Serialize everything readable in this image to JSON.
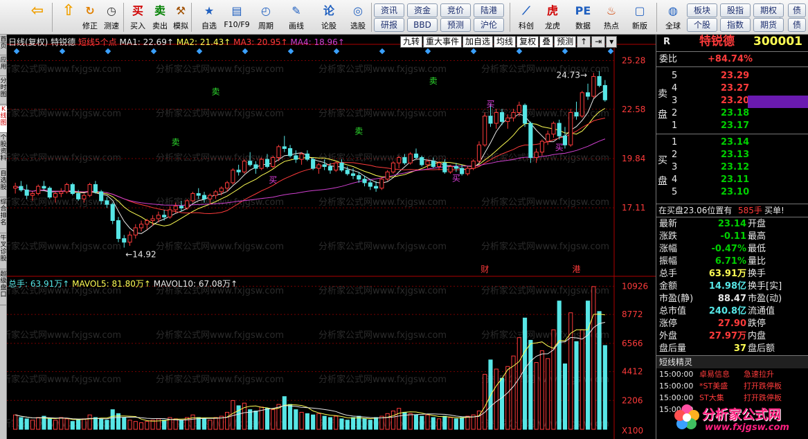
{
  "toolbar": {
    "buttons": [
      {
        "label": "",
        "icon": "back-arrow-icon",
        "glyph": "⇦",
        "color": "#f0a000"
      },
      {
        "label": "",
        "icon": "up-arrow-icon",
        "glyph": "⇧",
        "color": "#f0a000"
      },
      {
        "label": "修正",
        "icon": "refresh-icon",
        "glyph": "↻",
        "color": "#e08000"
      },
      {
        "label": "测速",
        "icon": "clock-icon",
        "glyph": "◷",
        "color": "#333333"
      },
      {
        "label": "买入",
        "icon": "buy-icon",
        "glyph": "买",
        "color": "#d00000"
      },
      {
        "label": "卖出",
        "icon": "sell-icon",
        "glyph": "卖",
        "color": "#008000"
      },
      {
        "label": "模拟",
        "icon": "gavel-icon",
        "glyph": "⚒",
        "color": "#a05000"
      },
      {
        "label": "自选",
        "icon": "star-icon",
        "glyph": "★",
        "color": "#2060c0"
      },
      {
        "label": "F10/F9",
        "icon": "f10-icon",
        "glyph": "▤",
        "color": "#2060c0"
      },
      {
        "label": "周期",
        "icon": "period-icon",
        "glyph": "◴",
        "color": "#2060c0"
      },
      {
        "label": "画线",
        "icon": "pencil-icon",
        "glyph": "✎",
        "color": "#2060c0"
      },
      {
        "label": "论股",
        "icon": "discuss-icon",
        "glyph": "论",
        "color": "#2060c0"
      },
      {
        "label": "选股",
        "icon": "select-stock-icon",
        "glyph": "◎",
        "color": "#2060c0"
      },
      {
        "label": "科创",
        "icon": "chart-icon",
        "glyph": "⟋",
        "color": "#2060c0"
      },
      {
        "label": "龙虎",
        "icon": "dragon-icon",
        "glyph": "虎",
        "color": "#d00000"
      },
      {
        "label": "数据",
        "icon": "pe-icon",
        "glyph": "PE",
        "color": "#2060c0"
      },
      {
        "label": "热点",
        "icon": "fire-icon",
        "glyph": "♨",
        "color": "#d04000"
      },
      {
        "label": "新版",
        "icon": "new-version-icon",
        "glyph": "▢",
        "color": "#2060c0"
      },
      {
        "label": "全球",
        "icon": "globe-icon",
        "glyph": "◍",
        "color": "#2060c0"
      }
    ],
    "small_buttons": [
      "资讯",
      "资金",
      "竞价",
      "陆港",
      "研报",
      "BBD",
      "预测",
      "沪伦",
      "板块",
      "股指",
      "期权",
      "个股",
      "指数",
      "期货",
      "债",
      "债"
    ]
  },
  "left_tabs": [
    "首页",
    "应用",
    "分时图",
    "K线图",
    "个股资料",
    "自选股",
    "综合排名",
    "牛叉诊股",
    "超级盘口"
  ],
  "chart": {
    "info": {
      "period": "日线(复权)",
      "name": "特锐德",
      "indicator": "短线5个点",
      "ma1": "MA1: 22.69↑",
      "ma2": "MA2: 21.43↑",
      "ma3": "MA3: 20.95↑",
      "ma4": "MA4: 18.96↑"
    },
    "menu": [
      "九转",
      "重大事件",
      "加自选",
      "均线",
      "复权",
      "叠",
      "预测"
    ],
    "menu_icons": [
      "↑",
      "⇥",
      "▾"
    ],
    "price_ticks": [
      "25.28",
      "22.58",
      "19.84",
      "17.11"
    ],
    "volume_ticks": [
      "10926",
      "8772",
      "6566",
      "4412",
      "2206",
      "X100"
    ],
    "vol_info": {
      "total": "总手: 63.91万↑",
      "mavol5": "MAVOL5: 81.80万↑",
      "mavol10": "MAVOL10: 67.08万↑"
    },
    "labels": {
      "high": "24.73",
      "low": "14.92",
      "cai": "财",
      "gang": "港"
    },
    "signals": [
      "卖",
      "卖",
      "卖",
      "卖",
      "买",
      "买",
      "买",
      "买"
    ],
    "watermark": "分析家公式网www.fxjgsw.com",
    "colors": {
      "up": "#ff3b3b",
      "down": "#57e6e6",
      "ma1": "#e8e8e8",
      "ma2": "#ffff54",
      "ma3": "#ff3b3b",
      "ma4": "#d040d0"
    }
  },
  "chart_data": {
    "type": "candlestick",
    "price_range": [
      13.5,
      25.8
    ],
    "volume_range": [
      0,
      11000
    ],
    "candles": [
      [
        18.2,
        18.5,
        17.9,
        18.3
      ],
      [
        18.3,
        18.6,
        18.0,
        18.1
      ],
      [
        18.1,
        18.4,
        17.6,
        17.8
      ],
      [
        17.8,
        18.0,
        17.5,
        17.9
      ],
      [
        17.9,
        18.4,
        17.8,
        18.3
      ],
      [
        18.3,
        18.6,
        18.1,
        18.2
      ],
      [
        18.2,
        18.3,
        17.6,
        17.7
      ],
      [
        17.7,
        18.0,
        17.4,
        17.9
      ],
      [
        17.9,
        18.2,
        17.7,
        18.0
      ],
      [
        18.0,
        18.5,
        17.9,
        18.4
      ],
      [
        18.4,
        18.5,
        17.8,
        17.9
      ],
      [
        17.9,
        18.1,
        17.5,
        17.6
      ],
      [
        17.6,
        17.9,
        17.4,
        17.8
      ],
      [
        17.8,
        18.5,
        17.7,
        18.4
      ],
      [
        18.4,
        18.6,
        17.9,
        18.0
      ],
      [
        18.0,
        18.1,
        17.3,
        17.5
      ],
      [
        17.5,
        17.7,
        17.1,
        17.3
      ],
      [
        17.3,
        17.4,
        16.2,
        16.4
      ],
      [
        16.4,
        16.6,
        15.2,
        15.4
      ],
      [
        15.4,
        15.6,
        14.9,
        15.2
      ],
      [
        15.2,
        15.8,
        15.0,
        15.6
      ],
      [
        15.6,
        16.2,
        15.4,
        16.0
      ],
      [
        16.0,
        16.4,
        15.8,
        16.2
      ],
      [
        16.2,
        16.5,
        15.9,
        16.4
      ],
      [
        16.4,
        16.7,
        16.1,
        16.5
      ],
      [
        16.5,
        16.9,
        16.3,
        16.7
      ],
      [
        16.7,
        17.0,
        16.4,
        16.6
      ],
      [
        16.6,
        17.2,
        16.5,
        17.0
      ],
      [
        17.0,
        17.4,
        16.8,
        17.2
      ],
      [
        17.2,
        17.5,
        16.9,
        17.1
      ],
      [
        17.1,
        17.6,
        17.0,
        17.5
      ],
      [
        17.5,
        18.0,
        17.4,
        17.9
      ],
      [
        17.9,
        18.2,
        17.6,
        17.8
      ],
      [
        17.8,
        18.0,
        17.4,
        17.6
      ],
      [
        17.6,
        17.9,
        17.3,
        17.8
      ],
      [
        17.8,
        18.1,
        17.6,
        18.0
      ],
      [
        18.0,
        18.3,
        17.8,
        18.2
      ],
      [
        18.2,
        18.6,
        18.0,
        18.5
      ],
      [
        18.5,
        19.3,
        18.4,
        19.2
      ],
      [
        19.2,
        19.5,
        18.9,
        19.1
      ],
      [
        19.1,
        19.8,
        19.0,
        19.7
      ],
      [
        19.7,
        20.2,
        19.4,
        19.5
      ],
      [
        19.5,
        19.7,
        19.0,
        19.3
      ],
      [
        19.3,
        19.9,
        19.2,
        19.8
      ],
      [
        19.8,
        20.1,
        19.3,
        19.4
      ],
      [
        19.4,
        20.0,
        19.3,
        19.9
      ],
      [
        19.9,
        20.6,
        19.7,
        20.5
      ],
      [
        20.5,
        21.1,
        20.2,
        20.4
      ],
      [
        20.4,
        20.6,
        19.9,
        20.0
      ],
      [
        20.0,
        20.3,
        19.6,
        19.8
      ],
      [
        19.8,
        20.2,
        19.5,
        20.1
      ],
      [
        20.1,
        20.3,
        19.7,
        19.8
      ],
      [
        19.8,
        19.9,
        19.2,
        19.3
      ],
      [
        19.3,
        19.6,
        19.0,
        19.5
      ],
      [
        19.5,
        19.8,
        19.2,
        19.4
      ],
      [
        19.4,
        19.6,
        19.0,
        19.2
      ],
      [
        19.2,
        19.7,
        19.1,
        19.6
      ],
      [
        19.6,
        19.8,
        19.1,
        19.2
      ],
      [
        19.2,
        19.4,
        18.9,
        19.0
      ],
      [
        19.0,
        19.3,
        18.7,
        18.9
      ],
      [
        18.9,
        19.1,
        18.5,
        18.7
      ],
      [
        18.7,
        18.9,
        18.3,
        18.5
      ],
      [
        18.5,
        18.7,
        18.1,
        18.3
      ],
      [
        18.3,
        18.6,
        18.0,
        18.2
      ],
      [
        18.2,
        18.8,
        18.1,
        18.7
      ],
      [
        18.7,
        19.2,
        18.6,
        19.1
      ],
      [
        19.1,
        19.7,
        19.0,
        19.6
      ],
      [
        19.6,
        20.0,
        19.3,
        19.9
      ],
      [
        19.9,
        20.1,
        19.5,
        19.6
      ],
      [
        19.6,
        20.2,
        19.5,
        20.1
      ],
      [
        20.1,
        20.4,
        19.8,
        19.9
      ],
      [
        19.9,
        20.0,
        19.4,
        19.5
      ],
      [
        19.5,
        19.8,
        19.3,
        19.7
      ],
      [
        19.7,
        19.9,
        19.3,
        19.4
      ],
      [
        19.4,
        19.7,
        19.2,
        19.6
      ],
      [
        19.6,
        19.8,
        19.0,
        19.1
      ],
      [
        19.1,
        19.5,
        19.0,
        19.4
      ],
      [
        19.4,
        19.6,
        19.1,
        19.3
      ],
      [
        19.3,
        19.5,
        18.9,
        19.0
      ],
      [
        19.0,
        19.4,
        18.9,
        19.3
      ],
      [
        19.3,
        19.8,
        19.2,
        19.7
      ],
      [
        19.7,
        20.8,
        19.6,
        20.6
      ],
      [
        20.6,
        22.4,
        20.5,
        22.2
      ],
      [
        22.2,
        22.9,
        21.6,
        21.8
      ],
      [
        21.8,
        22.6,
        21.5,
        22.4
      ],
      [
        22.4,
        22.6,
        21.7,
        21.9
      ],
      [
        21.9,
        22.3,
        21.5,
        22.1
      ],
      [
        22.1,
        22.6,
        21.9,
        22.4
      ],
      [
        22.4,
        23.0,
        22.2,
        22.8
      ],
      [
        22.8,
        22.9,
        21.6,
        21.8
      ],
      [
        21.8,
        21.9,
        19.6,
        19.9
      ],
      [
        19.9,
        20.4,
        19.6,
        20.2
      ],
      [
        20.2,
        20.9,
        20.0,
        20.8
      ],
      [
        20.8,
        21.4,
        20.6,
        21.2
      ],
      [
        21.2,
        21.9,
        21.0,
        21.8
      ],
      [
        21.8,
        22.0,
        20.9,
        21.1
      ],
      [
        21.1,
        21.6,
        20.4,
        20.6
      ],
      [
        20.6,
        22.6,
        20.5,
        22.4
      ],
      [
        22.4,
        23.0,
        22.0,
        22.2
      ],
      [
        22.2,
        23.6,
        22.1,
        23.5
      ],
      [
        23.5,
        24.0,
        23.1,
        23.3
      ],
      [
        23.3,
        24.6,
        23.2,
        24.4
      ],
      [
        24.4,
        24.7,
        23.8,
        23.9
      ],
      [
        23.9,
        24.2,
        23.0,
        23.1
      ]
    ],
    "volumes": [
      1100,
      900,
      800,
      700,
      900,
      1000,
      800,
      700,
      900,
      800,
      600,
      700,
      800,
      1100,
      900,
      800,
      700,
      1500,
      1200,
      900,
      700,
      600,
      500,
      600,
      700,
      800,
      700,
      900,
      800,
      700,
      900,
      1100,
      900,
      800,
      700,
      900,
      1000,
      1300,
      2200,
      1800,
      2000,
      1500,
      1400,
      1700,
      1600,
      1500,
      1900,
      2500,
      1900,
      1500,
      1300,
      1200,
      1100,
      1200,
      1000,
      900,
      1000,
      800,
      700,
      900,
      1000,
      800,
      700,
      900,
      1000,
      1200,
      1400,
      1600,
      1300,
      1200,
      1100,
      1000,
      1100,
      900,
      800,
      1000,
      900,
      800,
      900,
      1000,
      1100,
      1400,
      4200,
      5300,
      4600,
      3900,
      4800,
      5600,
      7000,
      8500,
      6800,
      5100,
      6000,
      5400,
      7600,
      9800,
      5000,
      8900,
      6700,
      7600,
      9800,
      10900,
      9000,
      6400
    ],
    "signals": [
      {
        "i": 28,
        "type": "卖",
        "price": 20.6
      },
      {
        "i": 35,
        "type": "卖",
        "price": 23.4
      },
      {
        "i": 60,
        "type": "卖",
        "price": 21.2
      },
      {
        "i": 73,
        "type": "卖",
        "price": 24.0
      },
      {
        "i": 45,
        "type": "买",
        "price": 18.5
      },
      {
        "i": 77,
        "type": "买",
        "price": 18.6
      },
      {
        "i": 83,
        "type": "买",
        "price": 22.7
      },
      {
        "i": 95,
        "type": "买",
        "price": 20.3
      }
    ]
  },
  "quote": {
    "header_r": "R",
    "name": "特锐德",
    "code": "300001",
    "weibi_label": "委比",
    "weibi_value": "+84.74%",
    "sell_label": "卖盘",
    "buy_label": "买盘",
    "sell": [
      {
        "n": "5",
        "p": "23.29",
        "v": ""
      },
      {
        "n": "4",
        "p": "23.27",
        "v": ""
      },
      {
        "n": "3",
        "p": "23.20",
        "v": ""
      },
      {
        "n": "2",
        "p": "23.18",
        "v": ""
      },
      {
        "n": "1",
        "p": "23.17",
        "v": ""
      }
    ],
    "buy": [
      {
        "n": "1",
        "p": "23.14",
        "v": ""
      },
      {
        "n": "2",
        "p": "23.13",
        "v": ""
      },
      {
        "n": "3",
        "p": "23.12",
        "v": ""
      },
      {
        "n": "4",
        "p": "23.11",
        "v": ""
      },
      {
        "n": "5",
        "p": "23.10",
        "v": ""
      }
    ],
    "trade_note": "在买盘23.06位置有",
    "trade_lots": "585手",
    "trade_type": "买单!",
    "stats": [
      {
        "l": "最新",
        "v": "23.14",
        "vc": "green",
        "r": "开盘"
      },
      {
        "l": "涨跌",
        "v": "-0.11",
        "vc": "green",
        "r": "最高"
      },
      {
        "l": "涨幅",
        "v": "-0.47%",
        "vc": "green",
        "r": "最低"
      },
      {
        "l": "振幅",
        "v": "6.71%",
        "vc": "green",
        "r": "量比"
      },
      {
        "l": "总手",
        "v": "63.91万",
        "vc": "yel",
        "r": "换手"
      },
      {
        "l": "金额",
        "v": "14.98亿",
        "vc": "cyan",
        "r": "换手[实]"
      },
      {
        "l": "市盈(静)",
        "v": "88.47",
        "vc": "white",
        "r": "市盈(动)"
      },
      {
        "l": "总市值",
        "v": "240.8亿",
        "vc": "cyan",
        "r": "流通值"
      },
      {
        "l": "涨停",
        "v": "27.90",
        "vc": "red",
        "r": "跌停"
      },
      {
        "l": "外盘",
        "v": "27.97万",
        "vc": "red",
        "r": "内盘"
      },
      {
        "l": "盘后量",
        "v": "37",
        "vc": "yel",
        "r": "盘后额"
      }
    ],
    "news_title": "短线精灵",
    "news": [
      {
        "t": "15:00:00",
        "n": "卓易信息",
        "e": "急速拉升"
      },
      {
        "t": "15:00:00",
        "n": "*ST美盛",
        "e": "打开跌停板"
      },
      {
        "t": "15:00:00",
        "n": "ST大集",
        "e": "打开跌停板"
      },
      {
        "t": "15:00:00",
        "n": "",
        "e": ""
      }
    ],
    "logo_text": "分析家公式网",
    "logo_url": "www.fxjgsw.com"
  }
}
